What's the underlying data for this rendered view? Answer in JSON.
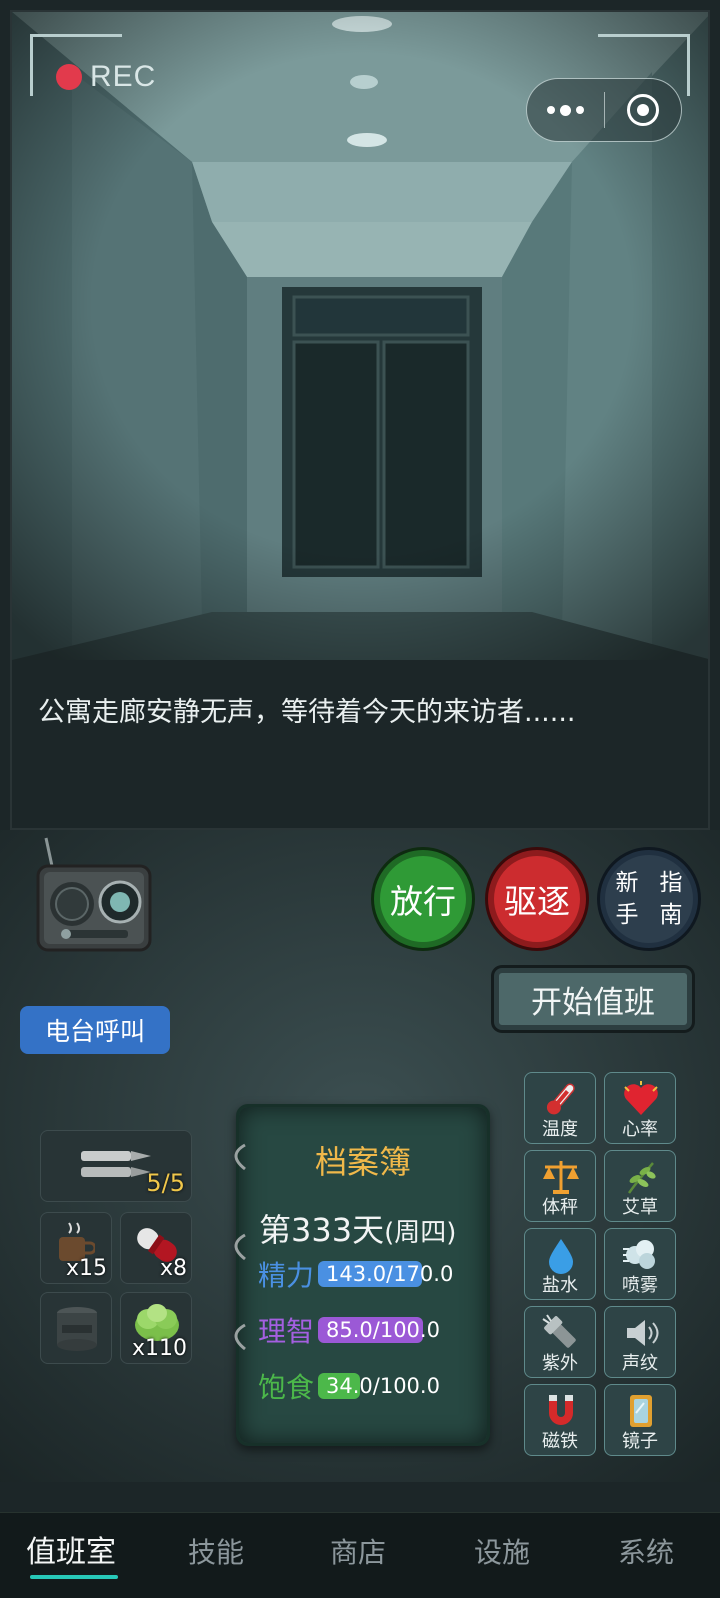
{
  "camera": {
    "rec_label": "REC",
    "caption": "公寓走廊安静无声，等待着今天的来访者......"
  },
  "capsule": {
    "more_icon": "more-dots-icon",
    "close_icon": "target-close-icon"
  },
  "actions": {
    "radio_call": "电台呼叫",
    "release": "放行",
    "expel": "驱逐",
    "guide_line1": "新手",
    "guide_line2": "指南",
    "start_shift": "开始值班"
  },
  "inventory": {
    "ammo": "5/5",
    "coffee": "x15",
    "pill": "x8",
    "cabbage": "x110"
  },
  "dossier": {
    "title": "档案簿",
    "day": "第333天",
    "weekday": "(周四)",
    "stats": [
      {
        "label": "精力",
        "value": "143.0/170.0",
        "current": 143.0,
        "max": 170.0,
        "color": "#4a90e2",
        "label_color": "#4a90e2"
      },
      {
        "label": "理智",
        "value": "85.0/100.0",
        "current": 85.0,
        "max": 100.0,
        "color": "#9b59d6",
        "label_color": "#a45fe0"
      },
      {
        "label": "饱食",
        "value": "34.0/100.0",
        "current": 34.0,
        "max": 100.0,
        "color": "#4cb84a",
        "label_color": "#4cb84a"
      }
    ]
  },
  "tools": [
    {
      "label": "温度",
      "icon": "thermometer-icon"
    },
    {
      "label": "心率",
      "icon": "heart-icon"
    },
    {
      "label": "体秤",
      "icon": "scale-icon"
    },
    {
      "label": "艾草",
      "icon": "mugwort-icon"
    },
    {
      "label": "盐水",
      "icon": "water-drop-icon"
    },
    {
      "label": "喷雾",
      "icon": "spray-icon"
    },
    {
      "label": "紫外",
      "icon": "uv-flashlight-icon"
    },
    {
      "label": "声纹",
      "icon": "speaker-icon"
    },
    {
      "label": "磁铁",
      "icon": "magnet-icon"
    },
    {
      "label": "镜子",
      "icon": "mirror-icon"
    }
  ],
  "nav": [
    {
      "label": "值班室",
      "active": true
    },
    {
      "label": "技能",
      "active": false
    },
    {
      "label": "商店",
      "active": false
    },
    {
      "label": "设施",
      "active": false
    },
    {
      "label": "系统",
      "active": false
    }
  ],
  "colors": {
    "release": "#2f9a36",
    "expel": "#cc2c2f",
    "radio_label": "#3472c6",
    "accent": "#27c8b8"
  }
}
